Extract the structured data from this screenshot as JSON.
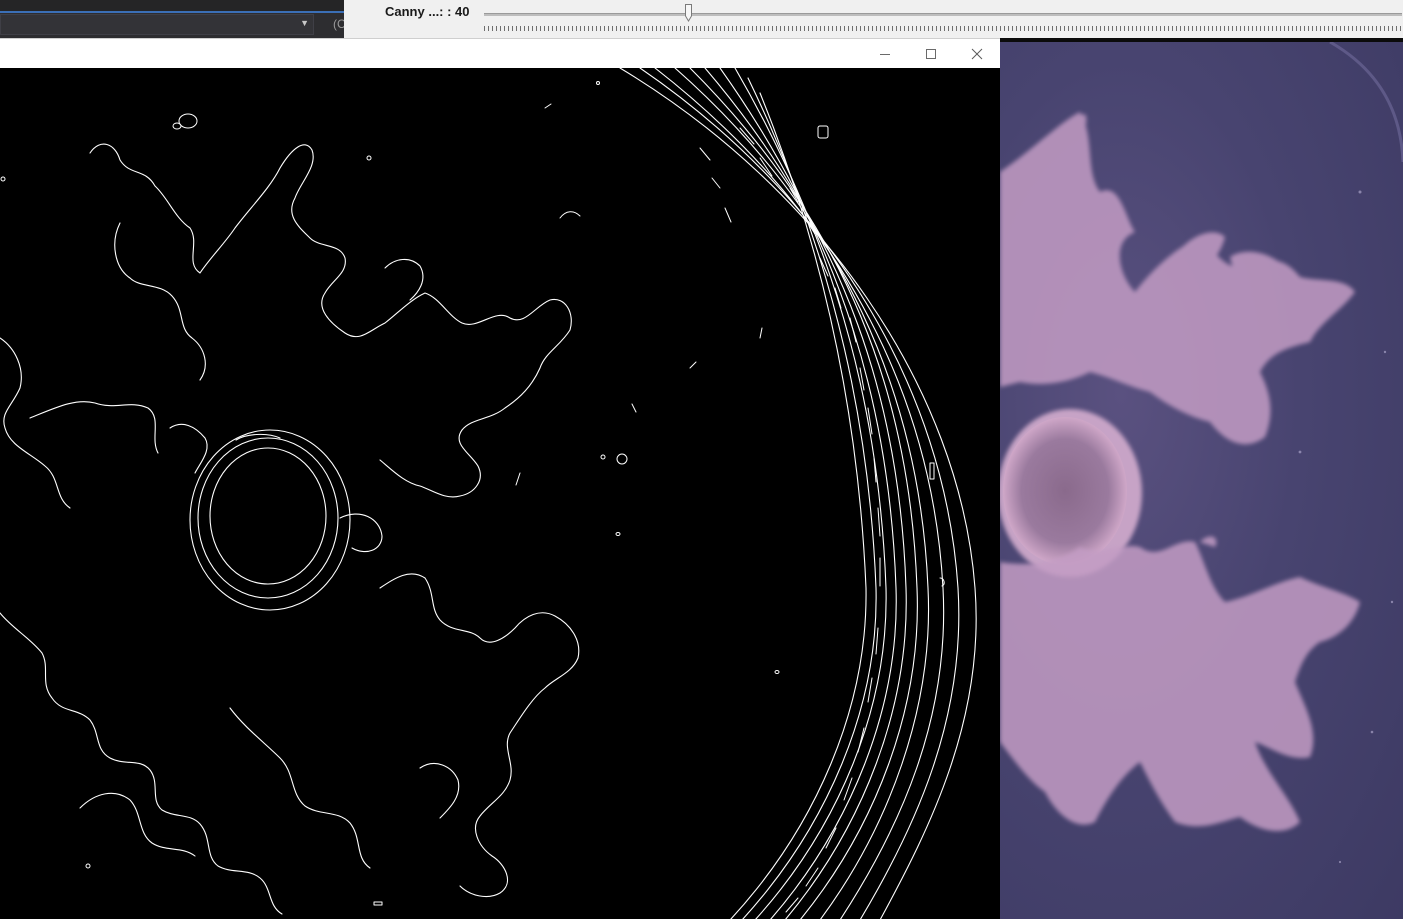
{
  "ide": {
    "side_text": "(C"
  },
  "trackbar": {
    "label": "Canny ...: : 40",
    "value": 40
  },
  "edge_window": {
    "controls": {
      "minimize_icon": "minimize-icon",
      "maximize_icon": "maximize-icon",
      "close_icon": "close-icon"
    }
  },
  "colors": {
    "ide_background": "#2d2d30",
    "ide_accent": "#3b6fb6",
    "trackbar_background": "#f0f0f0",
    "edge_background": "#000000",
    "edge_stroke": "#ffffff",
    "photo_background": "#484470",
    "colony": "#c9a2c9"
  }
}
